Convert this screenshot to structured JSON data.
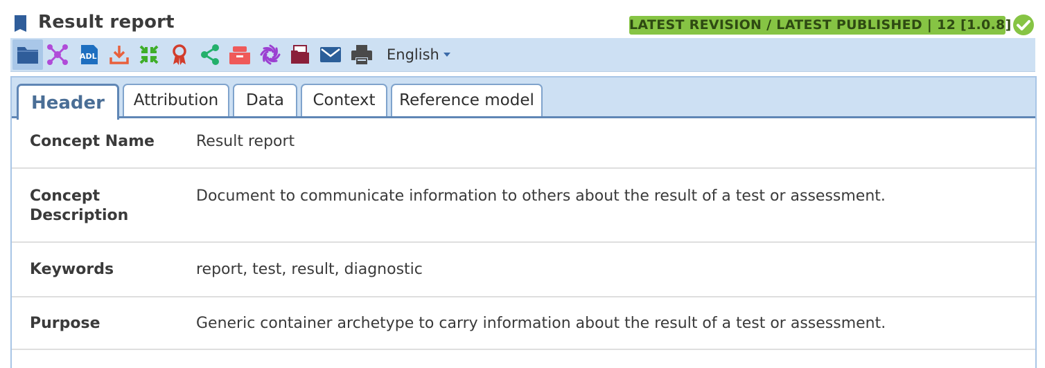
{
  "title": "Result report",
  "status_badge": "LATEST REVISION / LATEST PUBLISHED | 12 [1.0.8]",
  "toolbar": {
    "buttons": [
      {
        "name": "folder-icon",
        "color": "#2f5d9a"
      },
      {
        "name": "mindmap-icon",
        "color": "#b04bd8"
      },
      {
        "name": "adl-icon",
        "color": "#1e6fc0",
        "text": "ADL"
      },
      {
        "name": "download-icon",
        "color": "#e8603c"
      },
      {
        "name": "compress-icon",
        "color": "#3fae2a"
      },
      {
        "name": "award-icon",
        "color": "#d23c2b"
      },
      {
        "name": "share-icon",
        "color": "#23b06b"
      },
      {
        "name": "inbox-icon",
        "color": "#ef5a5a"
      },
      {
        "name": "aperture-icon",
        "color": "#9b3fd1"
      },
      {
        "name": "archive-icon",
        "color": "#8a1f3a"
      },
      {
        "name": "email-icon",
        "color": "#2b5e99"
      },
      {
        "name": "print-icon",
        "color": "#4a4a4a"
      }
    ],
    "language": "English"
  },
  "tabs": [
    {
      "label": "Header",
      "active": true
    },
    {
      "label": "Attribution",
      "active": false
    },
    {
      "label": "Data",
      "active": false
    },
    {
      "label": "Context",
      "active": false
    },
    {
      "label": "Reference model",
      "active": false
    }
  ],
  "rows": [
    {
      "label": "Concept Name",
      "value": "Result report"
    },
    {
      "label": "Concept Description",
      "value": "Document to communicate information to others about the result of a test or assessment."
    },
    {
      "label": "Keywords",
      "value": "report, test, result, diagnostic"
    },
    {
      "label": "Purpose",
      "value": "Generic container archetype to carry information about the result of a test or assessment."
    }
  ],
  "colors": {
    "badge_bg": "#86c444",
    "toolbar_bg": "#cde0f3",
    "tab_border": "#5f86b5",
    "active_tab_text": "#4a6e96"
  }
}
